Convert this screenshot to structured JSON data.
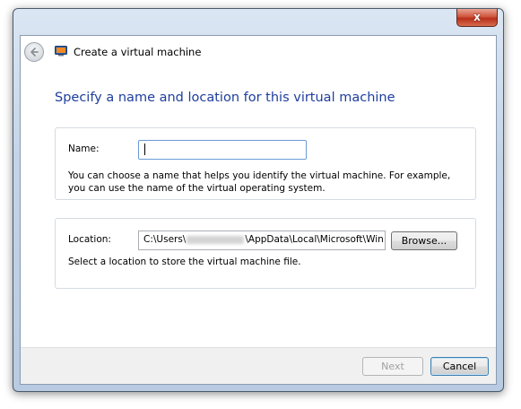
{
  "window": {
    "close_glyph": "x",
    "title": "Create a virtual machine"
  },
  "icons": {
    "back": "back-arrow-icon",
    "app": "virtual-pc-icon",
    "close": "close-icon"
  },
  "page": {
    "heading": "Specify a name and location for this virtual machine"
  },
  "name_section": {
    "label": "Name:",
    "value": "",
    "hint_line1": "You can choose a name that helps you identify the virtual machine. For example,",
    "hint_line2": "you can use the name of the virtual operating system."
  },
  "location_section": {
    "label": "Location:",
    "path_prefix": "C:\\Users\\",
    "path_suffix": "\\AppData\\Local\\Microsoft\\Win",
    "browse_label": "Browse...",
    "hint": "Select a location to store the virtual machine file."
  },
  "footer": {
    "next_label": "Next",
    "cancel_label": "Cancel"
  },
  "colors": {
    "heading": "#1e3e9e",
    "close_button": "#c8452c",
    "input_focus_border": "#6b9bd8"
  }
}
